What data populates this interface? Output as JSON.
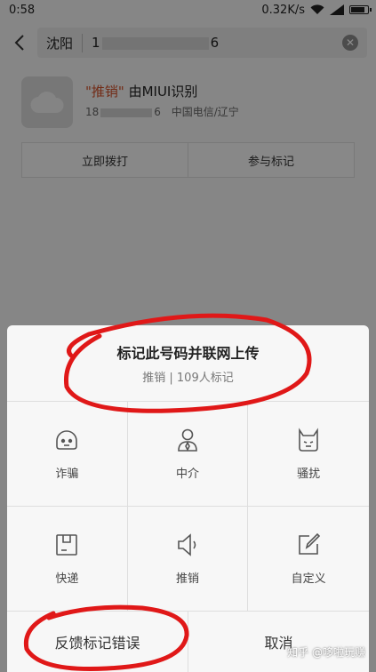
{
  "status": {
    "time": "0:58",
    "speed": "0.32K/s"
  },
  "search": {
    "city": "沈阳",
    "number_start": "1",
    "number_end": "6"
  },
  "caller": {
    "tag": "\"推销\"",
    "title_suffix": " 由MIUI识别",
    "number_start": "18",
    "number_end": "6",
    "carrier": "中国电信/辽宁"
  },
  "actions": {
    "call": "立即拨打",
    "mark": "参与标记"
  },
  "dialog": {
    "title": "标记此号码并联网上传",
    "subtitle": "推销 | 109人标记",
    "options": [
      {
        "label": "诈骗",
        "icon": "robot-face-icon"
      },
      {
        "label": "中介",
        "icon": "person-tie-icon"
      },
      {
        "label": "骚扰",
        "icon": "devil-face-icon"
      },
      {
        "label": "快递",
        "icon": "package-box-icon"
      },
      {
        "label": "推销",
        "icon": "megaphone-icon"
      },
      {
        "label": "自定义",
        "icon": "edit-pencil-icon"
      }
    ],
    "feedback": "反馈标记错误",
    "cancel": "取消"
  },
  "watermark": "知乎 @哆啦玩赚"
}
